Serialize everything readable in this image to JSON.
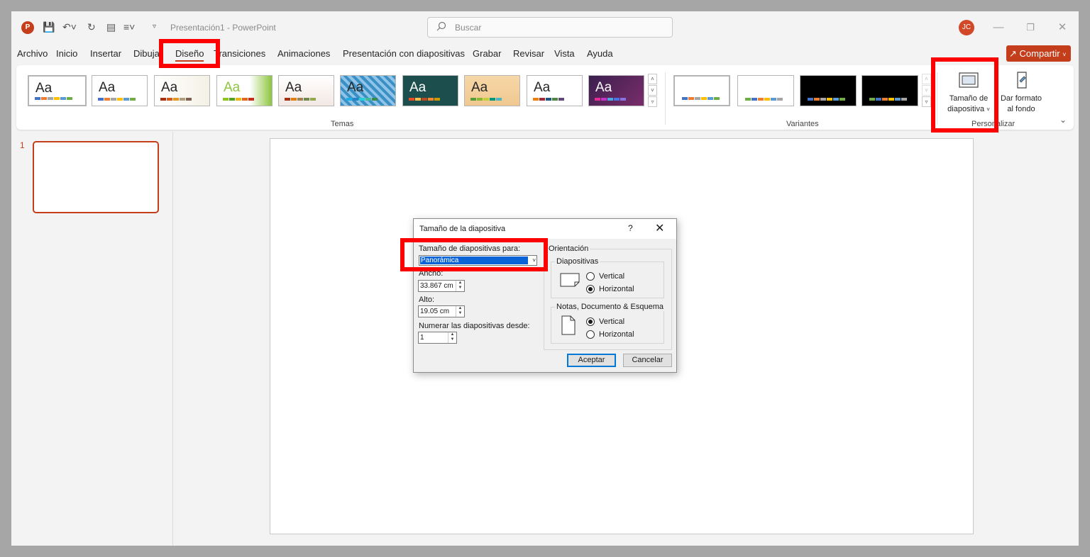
{
  "app": {
    "doc_title": "Presentación1 - PowerPoint",
    "logo_letter": "P",
    "avatar_initials": "JC"
  },
  "search": {
    "placeholder": "Buscar"
  },
  "tabs": [
    "Archivo",
    "Inicio",
    "Insertar",
    "Dibujar",
    "Diseño",
    "Transiciones",
    "Animaciones",
    "Presentación con diapositivas",
    "Grabar",
    "Revisar",
    "Vista",
    "Ayuda"
  ],
  "active_tab": "Diseño",
  "share_label": "Compartir",
  "ribbon": {
    "themes_label": "Temas",
    "variants_label": "Variantes",
    "customize_label": "Personalizar",
    "slide_size_line1": "Tamaño de",
    "slide_size_line2": "diapositiva",
    "format_bg_line1": "Dar formato",
    "format_bg_line2": "al fondo",
    "theme_sample": "Aa"
  },
  "thumbnails": {
    "slide_number": "1"
  },
  "dialog": {
    "title": "Tamaño de la diapositiva",
    "help": "?",
    "size_for_label": "Tamaño de diapositivas para:",
    "size_for_value": "Panorámica",
    "width_label": "Ancho:",
    "width_value": "33.867 cm",
    "height_label": "Alto:",
    "height_value": "19.05 cm",
    "number_from_label": "Numerar las diapositivas desde:",
    "number_from_value": "1",
    "orientation_label": "Orientación",
    "slides_group": "Diapositivas",
    "notes_group": "Notas, Documento & Esquema",
    "vertical": "Vertical",
    "horizontal": "Horizontal",
    "slides_selected": "Horizontal",
    "notes_selected": "Vertical",
    "ok": "Aceptar",
    "cancel": "Cancelar"
  },
  "colors": {
    "accent": "#c43e1c",
    "highlight": "#ff0000",
    "selection": "#0a64d8"
  }
}
